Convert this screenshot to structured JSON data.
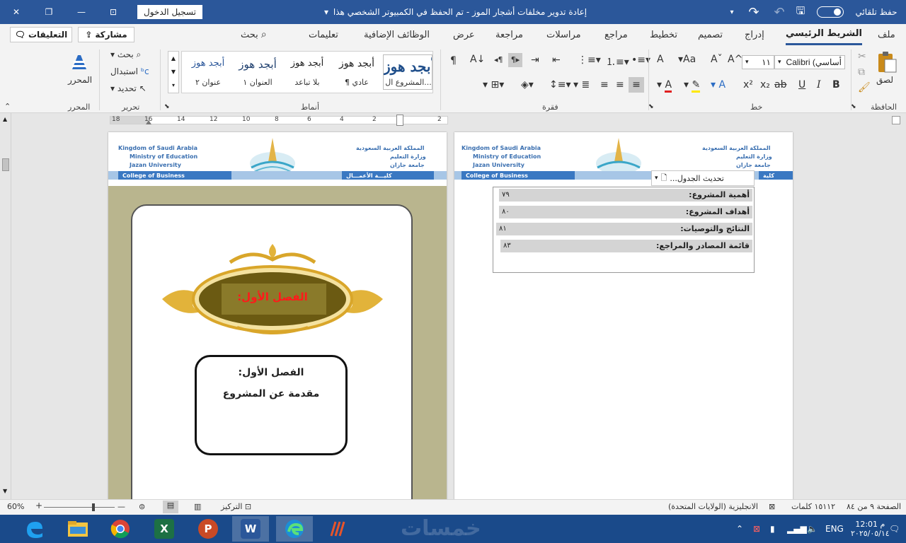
{
  "titlebar": {
    "title": "إعادة تدوير مخلفات أشجار الموز  -  تم الحفظ في الكمبيوتر الشخصي هذا",
    "autosave_label": "حفظ تلقائي",
    "signin_label": "تسجيل الدخول",
    "close_glyph": "✕",
    "restore_glyph": "❐",
    "minimize_glyph": "—",
    "ribbon_options_glyph": "⊡",
    "title_dropdown_glyph": "▾",
    "save_glyph": "🖫",
    "undo_glyph": "↶",
    "redo_glyph": "↷",
    "qat_more_glyph": "▾"
  },
  "tabs": {
    "file": "ملف",
    "home": "الشريط الرئيسي",
    "insert": "إدراج",
    "design": "تصميم",
    "layout": "تخطيط",
    "references": "مراجع",
    "mailings": "مراسلات",
    "review": "مراجعة",
    "view": "عرض",
    "addins": "الوظائف الإضافية",
    "help": "تعليمات",
    "search": "بحث",
    "share": "مشاركة",
    "comments": "التعليقات"
  },
  "ribbon": {
    "clipboard": {
      "label": "الحافظة",
      "paste": "لصق"
    },
    "font": {
      "label": "خط",
      "font_name": "Calibri (أساسي",
      "font_size": "١١",
      "bold": "B",
      "italic": "I",
      "underline": "U",
      "strike": "ab",
      "subscript": "x₂",
      "superscript": "x²",
      "font_color": "A",
      "clear": "A",
      "change_case": "Aa",
      "grow": "A^",
      "shrink": "Aˇ"
    },
    "paragraph": {
      "label": "فقرة",
      "show_marks": "¶"
    },
    "styles": {
      "label": "أنماط",
      "items": [
        {
          "sample": "أبجد هوز",
          "name": "المشروع ال..."
        },
        {
          "sample": "أبجد هوز",
          "name": "¶ عادي"
        },
        {
          "sample": "أبجد هوز",
          "name": "بلا تباعد"
        },
        {
          "sample": "أبجد هوز",
          "name": "العنوان ١"
        },
        {
          "sample": "أبجد هوز",
          "name": "عنوان ٢"
        }
      ]
    },
    "editing": {
      "label": "تحرير",
      "find": "بحث",
      "replace": "استبدال",
      "select": "تحديد"
    },
    "editor": {
      "label": "المحرر",
      "button": "المحرر"
    }
  },
  "ruler": {
    "numbers": [
      "2",
      "2",
      "4",
      "6",
      "8",
      "10",
      "12",
      "14",
      "16",
      "18"
    ]
  },
  "left_page": {
    "header": {
      "en1": "Kingdom of Saudi Arabia",
      "en2": "Ministry of Education",
      "en3": "Jazan University",
      "ar1": "المملكة العربية السعودية",
      "ar2": "وزارة التعليم",
      "ar3": "جامعة جازان",
      "college_en": "College of Business",
      "college_ar": "كليـــة الأعمـــال"
    },
    "banner_title": "الفصل الأول:",
    "box_line1": "الفصل الأول:",
    "box_line2": "مقدمة عن المشروع"
  },
  "right_page": {
    "header": {
      "en1": "Kingdom of Saudi Arabia",
      "en2": "Ministry of Education",
      "en3": "Jazan University",
      "ar1": "المملكة العربية السعودية",
      "ar2": "وزارة التعليم",
      "ar3": "جامعة جازان",
      "college_en": "College of Business",
      "college_ar": "كلية"
    },
    "toc_toolbar": "تحديث الجدول...",
    "toc": [
      {
        "title": "أهمية المشروع:",
        "page": "٧٩"
      },
      {
        "title": "أهداف المشروع:",
        "page": "٨٠"
      },
      {
        "title": "النتائج والتوصيات:",
        "page": "٨١"
      },
      {
        "title": "قائمة المصادر والمراجع:",
        "page": "٨٣"
      }
    ]
  },
  "status": {
    "page": "الصفحة ٩ من ٨٤",
    "words": "١٥١١٢ كلمات",
    "language": "الانجليزية (الولايات المتحدة)",
    "focus": "التركيز",
    "zoom": "60%",
    "zoom_minus": "—",
    "zoom_plus": "+"
  },
  "taskbar": {
    "lang": "ENG",
    "time": "12:01 م",
    "date": "٢٠٢٥/٠٥/١٤",
    "excel": "X",
    "powerpoint": "P",
    "word": "W",
    "watermark": "خمسات"
  },
  "colors": {
    "word_blue": "#2b579a",
    "taskbar": "#1a4a8a",
    "toc_row": "#d4d4d4",
    "olive": "#b9b58e",
    "banner_red": "#ff1a1a"
  }
}
